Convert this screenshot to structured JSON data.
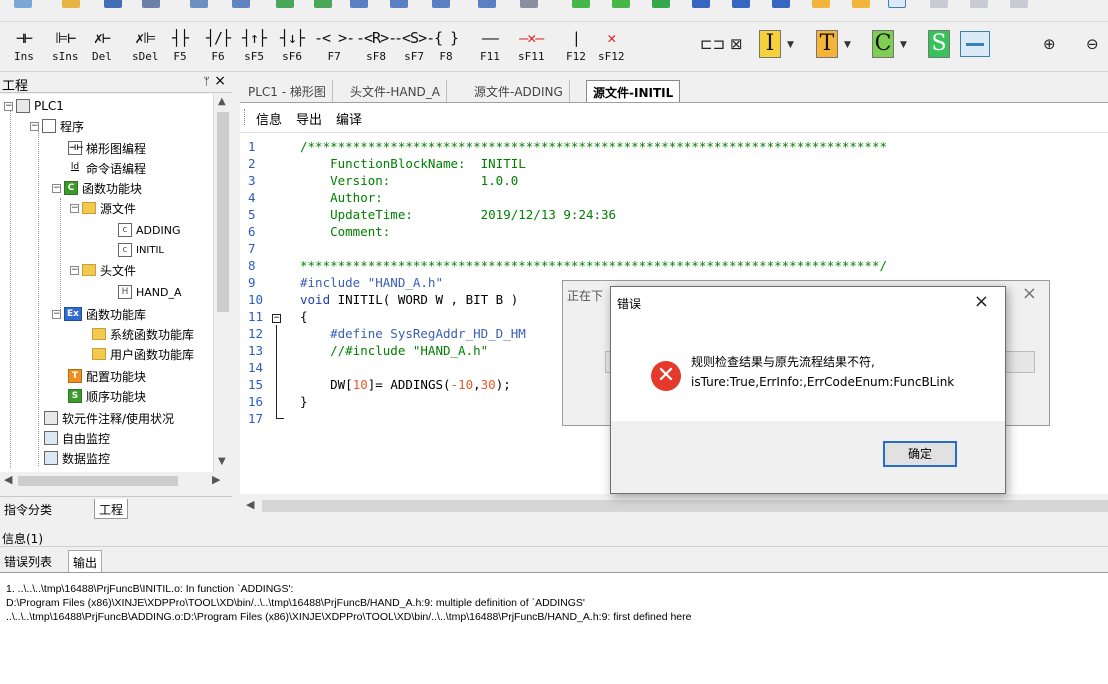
{
  "toolbar": {
    "ladder_buttons": [
      {
        "symbol": "⊣⊢",
        "key": "Ins"
      },
      {
        "symbol": "⊫⊢",
        "key": "sIns"
      },
      {
        "symbol": "✗⊢",
        "key": "Del"
      },
      {
        "symbol": "✗⊫",
        "key": "sDel"
      },
      {
        "symbol": "┤├",
        "key": "F5"
      },
      {
        "symbol": "┤/├",
        "key": "F6"
      },
      {
        "symbol": "┤↑├",
        "key": "sF5"
      },
      {
        "symbol": "┤↓├",
        "key": "sF6"
      },
      {
        "symbol": "-< >-",
        "key": "F7"
      },
      {
        "symbol": "-<R>-",
        "key": "sF8"
      },
      {
        "symbol": "-<S>-",
        "key": "sF7"
      },
      {
        "symbol": "{ }",
        "key": "F8"
      },
      {
        "symbol": "——",
        "key": "F11"
      },
      {
        "symbol": "—✕—",
        "key": "sF11"
      },
      {
        "symbol": "|",
        "key": "F12"
      },
      {
        "symbol": "✕",
        "key": "sF12"
      }
    ],
    "blocks": [
      "I",
      "T",
      "C",
      "S"
    ]
  },
  "project_panel": {
    "title": "工程",
    "pin": "ᛘ",
    "close": "×",
    "tree": [
      {
        "label": "PLC1",
        "icon": "plc-icon"
      },
      {
        "label": "程序",
        "icon": "doc-icon"
      },
      {
        "label": "梯形图编程",
        "icon": "ladder-icon"
      },
      {
        "label": "命令语编程",
        "icon": "ld-icon"
      },
      {
        "label": "函数功能块",
        "icon": "c-block-icon"
      },
      {
        "label": "源文件",
        "icon": "folder-icon"
      },
      {
        "label": "ADDING",
        "icon": "c-file-icon"
      },
      {
        "label": "INITIL",
        "icon": "c-file-icon"
      },
      {
        "label": "头文件",
        "icon": "folder-icon"
      },
      {
        "label": "HAND_A",
        "icon": "h-file-icon"
      },
      {
        "label": "函数功能库",
        "icon": "ex-icon"
      },
      {
        "label": "系统函数功能库",
        "icon": "folder-icon"
      },
      {
        "label": "用户函数功能库",
        "icon": "folder-icon"
      },
      {
        "label": "配置功能块",
        "icon": "t-block-icon"
      },
      {
        "label": "顺序功能块",
        "icon": "s-block-icon"
      },
      {
        "label": "软元件注释/使用状况",
        "icon": "list-icon"
      },
      {
        "label": "自由监控",
        "icon": "monitor-icon"
      },
      {
        "label": "数据监控",
        "icon": "data-monitor-icon"
      }
    ],
    "tabs": [
      "指令分类",
      "工程"
    ]
  },
  "editor": {
    "tabs": [
      "PLC1 - 梯形图",
      "头文件-HAND_A",
      "源文件-ADDING",
      "源文件-INITIL"
    ],
    "menu": [
      "信息",
      "导出",
      "编译"
    ],
    "line_numbers": [
      "1",
      "2",
      "3",
      "4",
      "5",
      "6",
      "7",
      "8",
      "9",
      "10",
      "11",
      "12",
      "13",
      "14",
      "15",
      "16",
      "17"
    ],
    "code": {
      "l1": "/*****************************************************************************",
      "l2": "    FunctionBlockName:  INITIL",
      "l3": "    Version:            1.0.0",
      "l4": "    Author:",
      "l5": "    UpdateTime:         2019/12/13 9:24:36",
      "l6": "    Comment:",
      "l7": "",
      "l8": "*****************************************************************************/",
      "l9": "#include \"HAND_A.h\"",
      "l10_kw": "void",
      "l10_rest": " INITIL( WORD W , BIT B )",
      "l11": "{",
      "l12": "    #define SysRegAddr_HD_D_HM",
      "l13": "    //#include \"HAND_A.h\"",
      "l14": "",
      "l15_a": "    DW[",
      "l15_n1": "10",
      "l15_b": "]= ADDINGS(",
      "l15_n2": "-10",
      "l15_c": ",",
      "l15_n3": "30",
      "l15_d": ");",
      "l16": "}",
      "l17": ""
    }
  },
  "bg_window": {
    "title": "正在下",
    "close": "×"
  },
  "error_dialog": {
    "title": "错误",
    "close": "×",
    "message_line1": "规则检查结果与原先流程结果不符,",
    "message_line2": "isTure:True,ErrInfo:,ErrCodeEnum:FuncBLink",
    "ok_label": "确定"
  },
  "info_panel": {
    "title": "信息(1)",
    "tabs": [
      "错误列表",
      "输出"
    ],
    "lines": [
      "1. ..\\..\\..\\tmp\\16488\\PrjFuncB\\INITIL.o: In function `ADDINGS':",
      "D:\\Program Files (x86)\\XINJE\\XDPPro\\TOOL\\XD\\bin/..\\..\\tmp\\16488\\PrjFuncB/HAND_A.h:9: multiple definition of `ADDINGS'",
      "..\\..\\..\\tmp\\16488\\PrjFuncB\\ADDING.o:D:\\Program Files (x86)\\XINJE\\XDPPro\\TOOL\\XD\\bin/..\\..\\tmp\\16488\\PrjFuncB/HAND_A.h:9: first defined here"
    ]
  },
  "colors": {
    "accent": "#2a6cc6",
    "error": "#e5392b",
    "comment": "#008000",
    "number": "#e05a2a"
  }
}
